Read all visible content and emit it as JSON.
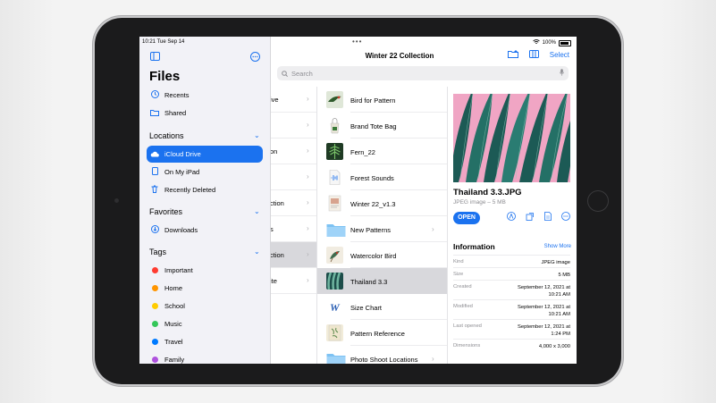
{
  "status": {
    "time": "10:21 Tue Sep 14",
    "battery": "100%"
  },
  "sidebar": {
    "title": "Files",
    "top_items": [
      {
        "label": "Recents",
        "icon": "clock-icon"
      },
      {
        "label": "Shared",
        "icon": "shared-folder-icon"
      }
    ],
    "locations_header": "Locations",
    "locations": [
      {
        "label": "iCloud Drive",
        "icon": "cloud-icon",
        "selected": true
      },
      {
        "label": "On My iPad",
        "icon": "ipad-icon"
      },
      {
        "label": "Recently Deleted",
        "icon": "trash-icon"
      }
    ],
    "favorites_header": "Favorites",
    "favorites": [
      {
        "label": "Downloads",
        "icon": "download-icon"
      }
    ],
    "tags_header": "Tags",
    "tags": [
      {
        "label": "Important",
        "color": "#ff3b30"
      },
      {
        "label": "Home",
        "color": "#ff9500"
      },
      {
        "label": "School",
        "color": "#ffcc00"
      },
      {
        "label": "Music",
        "color": "#34c759"
      },
      {
        "label": "Travel",
        "color": "#007aff"
      },
      {
        "label": "Family",
        "color": "#af52de"
      }
    ]
  },
  "toolbar": {
    "title": "Winter 22 Collection",
    "select_label": "Select",
    "search_placeholder": "Search"
  },
  "column1": [
    {
      "label": "ive"
    },
    {
      "label": ""
    },
    {
      "label": "on"
    },
    {
      "label": ""
    },
    {
      "label": "ction"
    },
    {
      "label": "s"
    },
    {
      "label": "ction",
      "selected": true
    },
    {
      "label": "ite"
    }
  ],
  "files": [
    {
      "name": "Bird for Pattern",
      "thumb": "bird"
    },
    {
      "name": "Brand Tote Bag",
      "thumb": "tote"
    },
    {
      "name": "Fern_22",
      "thumb": "fern"
    },
    {
      "name": "Forest Sounds",
      "thumb": "audio"
    },
    {
      "name": "Winter 22_v1.3",
      "thumb": "doc"
    },
    {
      "name": "New Patterns",
      "thumb": "folder",
      "folder": true
    },
    {
      "name": "Watercolor Bird",
      "thumb": "wbird"
    },
    {
      "name": "Thailand 3.3",
      "thumb": "leaves",
      "selected": true
    },
    {
      "name": "Size Chart",
      "thumb": "word"
    },
    {
      "name": "Pattern Reference",
      "thumb": "ref"
    },
    {
      "name": "Photo Shoot Locations",
      "thumb": "folder",
      "folder": true
    }
  ],
  "detail": {
    "title": "Thailand 3.3.JPG",
    "subtitle": "JPEG image – 5 MB",
    "open_label": "OPEN",
    "info_header": "Information",
    "show_more": "Show More",
    "rows": [
      {
        "key": "Kind",
        "value": "JPEG image"
      },
      {
        "key": "Size",
        "value": "5 MB"
      },
      {
        "key": "Created",
        "value": "September 12, 2021 at",
        "value2": "10:21 AM"
      },
      {
        "key": "Modified",
        "value": "September 12, 2021 at",
        "value2": "10:21 AM"
      },
      {
        "key": "Last opened",
        "value": "September 12, 2021 at",
        "value2": "1:24 PM"
      },
      {
        "key": "Dimensions",
        "value": "4,000 x 3,000"
      }
    ]
  }
}
